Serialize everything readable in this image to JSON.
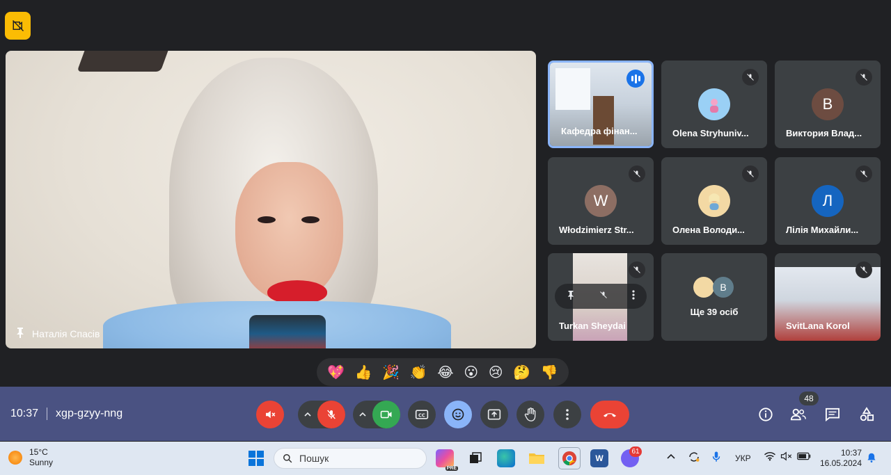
{
  "main_speaker": {
    "name": "Наталія Спасів"
  },
  "participants": [
    {
      "name": "Кафедра фінан...",
      "avatar_letter": "",
      "avatar_color": "",
      "state": "speaking"
    },
    {
      "name": "Olena Stryhuniv...",
      "avatar_letter": "",
      "avatar_color": "#9ad0f5",
      "state": "muted"
    },
    {
      "name": "Виктория Влад...",
      "avatar_letter": "В",
      "avatar_color": "#6d4c41",
      "state": "muted"
    },
    {
      "name": "Włodzimierz Str...",
      "avatar_letter": "W",
      "avatar_color": "#8d6e63",
      "state": "muted"
    },
    {
      "name": "Олена Володи...",
      "avatar_letter": "",
      "avatar_color": "#f3d9a4",
      "state": "muted"
    },
    {
      "name": "Лілія Михайли...",
      "avatar_letter": "Л",
      "avatar_color": "#1565c0",
      "state": "muted"
    },
    {
      "name": "Turkan Sheydai",
      "avatar_letter": "",
      "avatar_color": "",
      "state": "muted"
    },
    {
      "name": "Ще 39 осіб",
      "avatar_letter": "В",
      "avatar_color": "#607d8b",
      "state": "more"
    },
    {
      "name": "SvitLana Korol",
      "avatar_letter": "",
      "avatar_color": "",
      "state": "muted"
    }
  ],
  "reactions": [
    "💖",
    "👍",
    "🎉",
    "👏",
    "😂",
    "😮",
    "😢",
    "🤔",
    "👎"
  ],
  "controls": {
    "time": "10:37",
    "meeting_code": "xgp-gzyy-nng",
    "participants_count": "48"
  },
  "taskbar": {
    "weather_temp": "15°C",
    "weather_desc": "Sunny",
    "search_placeholder": "Пошук",
    "language": "УКР",
    "clock_time": "10:37",
    "clock_date": "16.05.2024",
    "viber_badge": "61",
    "copilot_badge": "PRE"
  },
  "colors": {
    "meet_bg": "#202124",
    "tile_bg": "#3c4043",
    "control_bar": "#4a5282",
    "end_call": "#ea4335",
    "camera_on": "#34a853",
    "active_border": "#8ab4f8"
  }
}
